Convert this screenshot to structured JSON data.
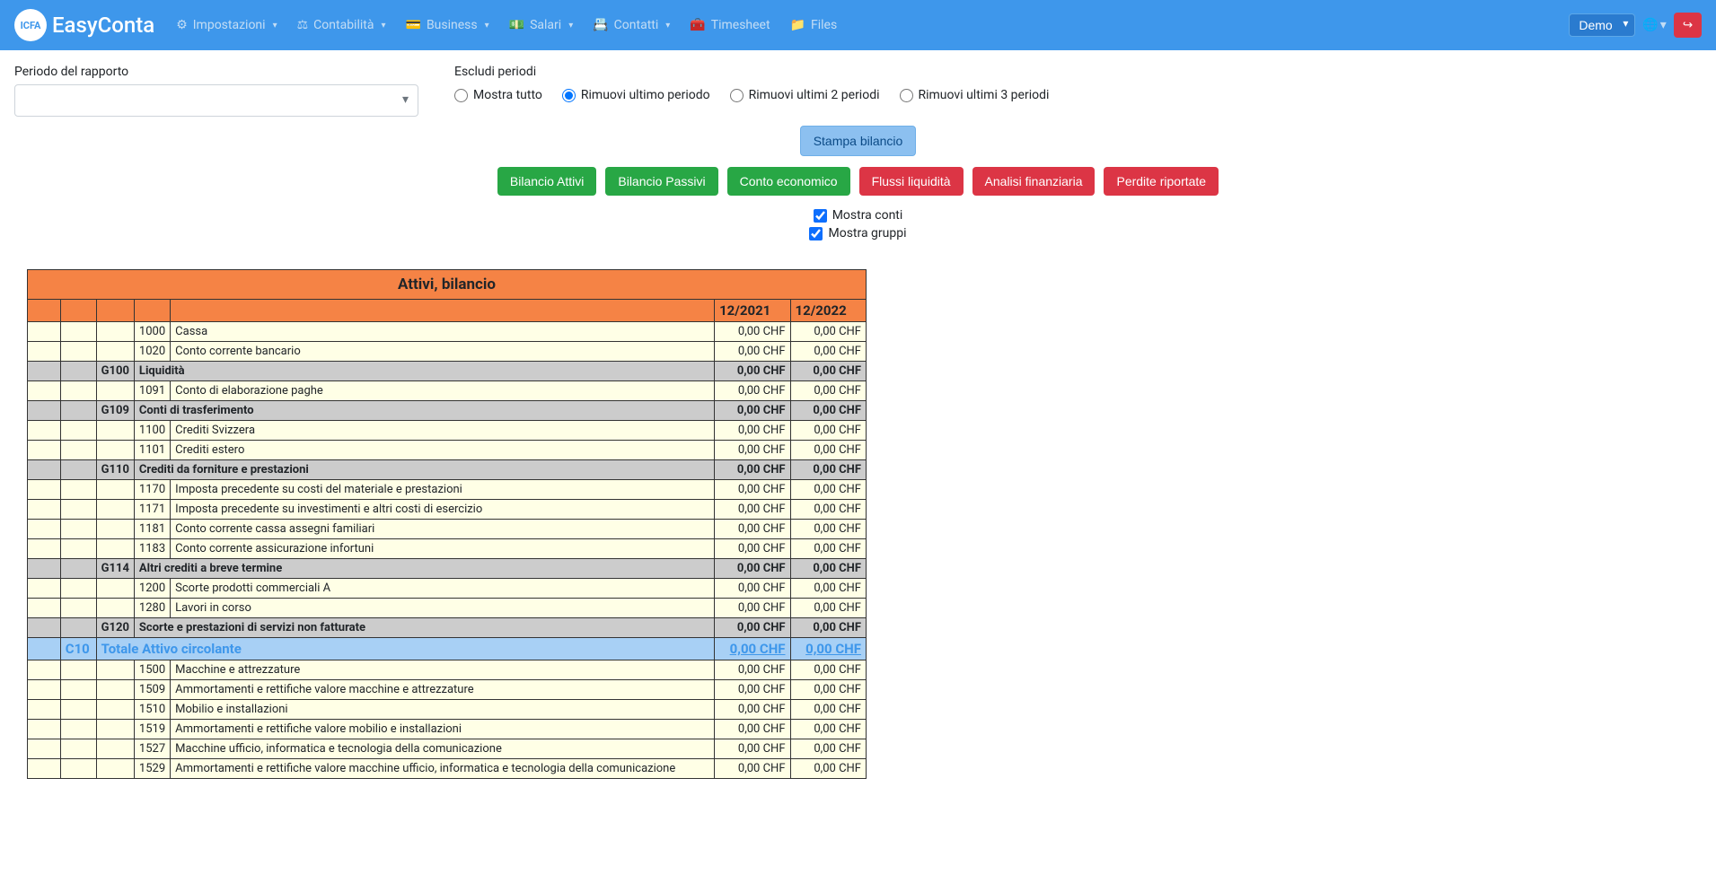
{
  "app": {
    "name": "EasyConta",
    "logo_text": "ICFA"
  },
  "nav": {
    "items": [
      {
        "label": "Impostazioni",
        "icon": "⚙"
      },
      {
        "label": "Contabilità",
        "icon": "⚖"
      },
      {
        "label": "Business",
        "icon": "💳"
      },
      {
        "label": "Salari",
        "icon": "💵"
      },
      {
        "label": "Contatti",
        "icon": "📇"
      },
      {
        "label": "Timesheet",
        "icon": "🧰"
      },
      {
        "label": "Files",
        "icon": "📁"
      }
    ],
    "demo_label": "Demo"
  },
  "filters": {
    "period_label": "Periodo del rapporto",
    "exclude_label": "Escludi periodi",
    "radios": [
      "Mostra tutto",
      "Rimuovi ultimo periodo",
      "Rimuovi ultimi 2 periodi",
      "Rimuovi ultimi 3 periodi"
    ],
    "selected_radio": 1,
    "print_label": "Stampa bilancio",
    "reports": [
      {
        "label": "Bilancio Attivi",
        "cls": "btn-green"
      },
      {
        "label": "Bilancio Passivi",
        "cls": "btn-green"
      },
      {
        "label": "Conto economico",
        "cls": "btn-green"
      },
      {
        "label": "Flussi liquidità",
        "cls": "btn-red"
      },
      {
        "label": "Analisi finanziaria",
        "cls": "btn-red"
      },
      {
        "label": "Perdite riportate",
        "cls": "btn-red"
      }
    ],
    "check_accounts": "Mostra conti",
    "check_groups": "Mostra gruppi"
  },
  "report": {
    "title": "Attivi, bilancio",
    "columns": [
      "12/2021",
      "12/2022"
    ],
    "rows": [
      {
        "type": "account",
        "code": "1000",
        "desc": "Cassa",
        "v1": "0,00 CHF",
        "v2": "0,00 CHF"
      },
      {
        "type": "account",
        "code": "1020",
        "desc": "Conto corrente bancario",
        "v1": "0,00 CHF",
        "v2": "0,00 CHF"
      },
      {
        "type": "group",
        "group": "G100",
        "desc": "Liquidità",
        "v1": "0,00 CHF",
        "v2": "0,00 CHF"
      },
      {
        "type": "account",
        "code": "1091",
        "desc": "Conto di elaborazione paghe",
        "v1": "0,00 CHF",
        "v2": "0,00 CHF"
      },
      {
        "type": "group",
        "group": "G109",
        "desc": "Conti di trasferimento",
        "v1": "0,00 CHF",
        "v2": "0,00 CHF"
      },
      {
        "type": "account",
        "code": "1100",
        "desc": "Crediti Svizzera",
        "v1": "0,00 CHF",
        "v2": "0,00 CHF"
      },
      {
        "type": "account",
        "code": "1101",
        "desc": "Crediti estero",
        "v1": "0,00 CHF",
        "v2": "0,00 CHF"
      },
      {
        "type": "group",
        "group": "G110",
        "desc": "Crediti da forniture e prestazioni",
        "v1": "0,00 CHF",
        "v2": "0,00 CHF"
      },
      {
        "type": "account",
        "code": "1170",
        "desc": "Imposta precedente su costi del materiale e prestazioni",
        "v1": "0,00 CHF",
        "v2": "0,00 CHF"
      },
      {
        "type": "account",
        "code": "1171",
        "desc": "Imposta precedente su investimenti e altri costi di esercizio",
        "v1": "0,00 CHF",
        "v2": "0,00 CHF"
      },
      {
        "type": "account",
        "code": "1181",
        "desc": "Conto corrente cassa assegni familiari",
        "v1": "0,00 CHF",
        "v2": "0,00 CHF"
      },
      {
        "type": "account",
        "code": "1183",
        "desc": "Conto corrente assicurazione infortuni",
        "v1": "0,00 CHF",
        "v2": "0,00 CHF"
      },
      {
        "type": "group",
        "group": "G114",
        "desc": "Altri crediti a breve termine",
        "v1": "0,00 CHF",
        "v2": "0,00 CHF"
      },
      {
        "type": "account",
        "code": "1200",
        "desc": "Scorte prodotti commerciali A",
        "v1": "0,00 CHF",
        "v2": "0,00 CHF"
      },
      {
        "type": "account",
        "code": "1280",
        "desc": "Lavori in corso",
        "v1": "0,00 CHF",
        "v2": "0,00 CHF"
      },
      {
        "type": "group",
        "group": "G120",
        "desc": "Scorte e prestazioni di servizi non fatturate",
        "v1": "0,00 CHF",
        "v2": "0,00 CHF"
      },
      {
        "type": "class",
        "class": "C10",
        "desc": "Totale Attivo circolante",
        "v1": "0,00 CHF",
        "v2": "0,00 CHF"
      },
      {
        "type": "account",
        "code": "1500",
        "desc": "Macchine e attrezzature",
        "v1": "0,00 CHF",
        "v2": "0,00 CHF"
      },
      {
        "type": "account",
        "code": "1509",
        "desc": "Ammortamenti e rettifiche valore macchine e attrezzature",
        "v1": "0,00 CHF",
        "v2": "0,00 CHF"
      },
      {
        "type": "account",
        "code": "1510",
        "desc": "Mobilio e installazioni",
        "v1": "0,00 CHF",
        "v2": "0,00 CHF"
      },
      {
        "type": "account",
        "code": "1519",
        "desc": "Ammortamenti e rettifiche valore mobilio e installazioni",
        "v1": "0,00 CHF",
        "v2": "0,00 CHF"
      },
      {
        "type": "account",
        "code": "1527",
        "desc": "Macchine ufficio, informatica e tecnologia della comunicazione",
        "v1": "0,00 CHF",
        "v2": "0,00 CHF"
      },
      {
        "type": "account",
        "code": "1529",
        "desc": "Ammortamenti e rettifiche valore macchine ufficio, informatica e tecnologia della comunicazione",
        "v1": "0,00 CHF",
        "v2": "0,00 CHF"
      }
    ]
  }
}
